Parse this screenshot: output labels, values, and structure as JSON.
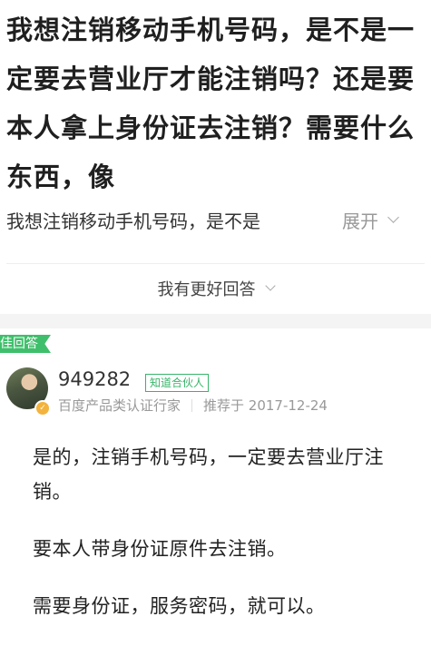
{
  "question": {
    "title": "我想注销移动手机号码，是不是一定要去营业厅才能注销吗？还是要本人拿上身份证去注销？需要什么东西，像",
    "excerpt": "我想注销移动手机号码，是不是",
    "expand_label": "展开"
  },
  "actions": {
    "better_answer_label": "我有更好回答"
  },
  "answer": {
    "tag_label": "佳回答",
    "username": "949282",
    "partner_badge": "知道合伙人",
    "user_title": "百度产品类认证行家",
    "recommend_text": "推荐于 2017-12-24",
    "paragraphs": [
      "是的，注销手机号码，一定要去营业厅注销。",
      "要本人带身份证原件去注销。",
      "需要身份证，服务密码，就可以。"
    ]
  },
  "colors": {
    "accent_green": "#3fbf6b",
    "badge_gold": "#f3b33d"
  }
}
